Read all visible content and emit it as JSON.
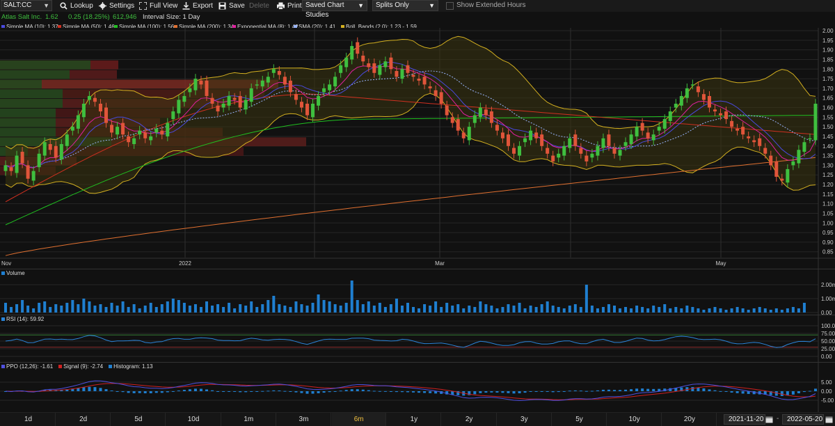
{
  "toolbar": {
    "symbol": "SALT:CC",
    "lookup": "Lookup",
    "settings": "Settings",
    "full_view": "Full View",
    "export": "Export",
    "save": "Save",
    "delete": "Delete",
    "print": "Print",
    "studies_select": "Saved Chart Studies",
    "splits_select": "Splits Only",
    "extended_hours": "Show Extended Hours"
  },
  "quote": {
    "name": "Atlas Salt Inc.",
    "last": "1.62",
    "change": "0.25 (18.25%)",
    "volume": "612,946",
    "interval": "Interval Size:  1 Day"
  },
  "colors": {
    "up": "#3fbf3f",
    "down": "#e0553a",
    "boll": "#d4b020",
    "sma10": "#4a4ae0",
    "sma50": "#d03020",
    "sma100": "#20c020",
    "sma200": "#e07030",
    "ema8": "#e020a0",
    "sma20": "#9ab6ff",
    "volume": "#1f7fd0",
    "rsi": "#2a84d8",
    "ppo": "#5050e0",
    "signal": "#d02020",
    "histogram": "#1f7fd0"
  },
  "legend": [
    {
      "label": "Simple MA (10): 1.37",
      "color": "#4a4ae0"
    },
    {
      "label": "Simple MA (50): 1.46",
      "color": "#d03020"
    },
    {
      "label": "Simple MA (100): 1.56",
      "color": "#20c020"
    },
    {
      "label": "Simple MA (200): 1.34",
      "color": "#e07030"
    },
    {
      "label": "Exponential MA (8): 1.42",
      "color": "#e020a0"
    },
    {
      "label": "SMA (20): 1.41",
      "color": "#9ab6ff"
    },
    {
      "label": "Boll. Bands (2.0): 1.23 - 1.59",
      "color": "#d4b020"
    }
  ],
  "price_axis": [
    "2.00",
    "1.95",
    "1.90",
    "1.85",
    "1.80",
    "1.75",
    "1.70",
    "1.65",
    "1.60",
    "1.55",
    "1.50",
    "1.45",
    "1.40",
    "1.35",
    "1.30",
    "1.25",
    "1.20",
    "1.15",
    "1.10",
    "1.05",
    "1.00",
    "0.95",
    "0.90",
    "0.85"
  ],
  "time_axis": [
    {
      "label": "Nov",
      "pos": "start"
    },
    {
      "label": "2022",
      "pos": "jan"
    },
    {
      "label": "Mar",
      "pos": "mar"
    },
    {
      "label": "May",
      "pos": "may"
    }
  ],
  "volume_panel": {
    "label": "Volume",
    "ticks": [
      "2.00m",
      "1.00m",
      "0.00"
    ]
  },
  "rsi_panel": {
    "label": "RSI (14): 59.92",
    "ticks": [
      "100.00",
      "75.00",
      "50.00",
      "25.00",
      "0.00"
    ]
  },
  "ppo_panel": {
    "labels": [
      {
        "text": "PPO (12,26): -1.61",
        "color": "#5050e0"
      },
      {
        "text": "Signal (9): -2.74",
        "color": "#d02020"
      },
      {
        "text": "Histogram: 1.13",
        "color": "#1f7fd0"
      }
    ],
    "ticks": [
      "5.00",
      "0.00",
      "-5.00"
    ]
  },
  "ranges": [
    {
      "label": "1d"
    },
    {
      "label": "2d"
    },
    {
      "label": "5d"
    },
    {
      "label": "10d"
    },
    {
      "label": "1m"
    },
    {
      "label": "3m"
    },
    {
      "label": "6m",
      "active": true
    },
    {
      "label": "1y"
    },
    {
      "label": "2y"
    },
    {
      "label": "3y"
    },
    {
      "label": "5y"
    },
    {
      "label": "10y"
    },
    {
      "label": "20y"
    }
  ],
  "date_from": "2021-11-20",
  "date_to": "2022-05-20",
  "chart_data": {
    "type": "candlestick",
    "ylim": [
      0.82,
      2.0
    ],
    "closes": [
      1.3,
      1.27,
      1.35,
      1.31,
      1.23,
      1.27,
      1.36,
      1.42,
      1.38,
      1.34,
      1.41,
      1.46,
      1.5,
      1.56,
      1.62,
      1.66,
      1.63,
      1.58,
      1.52,
      1.47,
      1.5,
      1.46,
      1.42,
      1.44,
      1.48,
      1.44,
      1.45,
      1.49,
      1.46,
      1.52,
      1.58,
      1.64,
      1.66,
      1.7,
      1.75,
      1.72,
      1.66,
      1.62,
      1.58,
      1.62,
      1.66,
      1.64,
      1.6,
      1.64,
      1.7,
      1.72,
      1.74,
      1.76,
      1.8,
      1.77,
      1.72,
      1.68,
      1.64,
      1.6,
      1.56,
      1.62,
      1.66,
      1.7,
      1.72,
      1.76,
      1.82,
      1.86,
      1.92,
      1.88,
      1.84,
      1.81,
      1.78,
      1.82,
      1.84,
      1.8,
      1.76,
      1.8,
      1.78,
      1.76,
      1.74,
      1.72,
      1.7,
      1.66,
      1.62,
      1.56,
      1.52,
      1.48,
      1.44,
      1.5,
      1.56,
      1.6,
      1.56,
      1.52,
      1.48,
      1.44,
      1.4,
      1.36,
      1.4,
      1.44,
      1.48,
      1.44,
      1.4,
      1.36,
      1.32,
      1.36,
      1.4,
      1.44,
      1.4,
      1.36,
      1.32,
      1.36,
      1.4,
      1.44,
      1.4,
      1.36,
      1.38,
      1.42,
      1.46,
      1.5,
      1.48,
      1.44,
      1.46,
      1.5,
      1.54,
      1.58,
      1.62,
      1.66,
      1.7,
      1.72,
      1.68,
      1.64,
      1.6,
      1.58,
      1.56,
      1.54,
      1.5,
      1.48,
      1.46,
      1.44,
      1.42,
      1.4,
      1.36,
      1.3,
      1.24,
      1.22,
      1.28,
      1.32,
      1.38,
      1.42,
      1.44,
      1.62
    ],
    "volume": [
      0.7,
      0.4,
      0.6,
      0.9,
      0.5,
      0.3,
      0.7,
      0.8,
      0.4,
      0.6,
      0.5,
      0.7,
      0.9,
      0.6,
      1.0,
      0.8,
      0.5,
      0.6,
      0.4,
      0.7,
      0.5,
      0.8,
      0.4,
      0.6,
      0.3,
      0.5,
      0.7,
      0.4,
      0.6,
      0.8,
      1.0,
      0.9,
      0.7,
      0.5,
      0.6,
      0.4,
      0.8,
      0.5,
      0.6,
      0.4,
      0.7,
      0.3,
      0.6,
      0.5,
      0.8,
      0.4,
      0.6,
      0.9,
      1.2,
      0.6,
      0.5,
      0.4,
      0.8,
      0.6,
      0.5,
      0.7,
      1.3,
      0.9,
      0.8,
      0.6,
      0.5,
      0.7,
      2.3,
      0.9,
      0.6,
      0.8,
      0.5,
      0.7,
      0.4,
      0.6,
      1.0,
      0.5,
      0.7,
      0.4,
      0.3,
      0.6,
      0.5,
      0.8,
      0.4,
      0.7,
      0.5,
      0.6,
      0.3,
      0.5,
      0.4,
      0.8,
      0.6,
      0.5,
      0.3,
      0.4,
      0.6,
      0.5,
      0.7,
      0.3,
      0.5,
      0.4,
      0.6,
      0.8,
      0.5,
      0.4,
      0.3,
      0.5,
      0.6,
      0.4,
      2.0,
      0.5,
      0.3,
      0.4,
      0.6,
      0.5,
      0.3,
      0.4,
      0.3,
      0.5,
      0.4,
      0.3,
      0.5,
      0.4,
      0.6,
      0.3,
      0.4,
      0.3,
      0.5,
      0.4,
      0.3,
      0.2,
      0.3,
      0.4,
      0.3,
      0.2,
      0.3,
      0.4,
      0.3,
      0.2,
      0.3,
      0.4,
      0.3,
      0.2,
      0.3,
      0.2,
      0.3,
      0.4,
      0.3,
      0.7
    ],
    "series": [
      {
        "name": "Simple MA (10)"
      },
      {
        "name": "Simple MA (50)"
      },
      {
        "name": "Simple MA (100)"
      },
      {
        "name": "Simple MA (200)"
      },
      {
        "name": "Exponential MA (8)"
      },
      {
        "name": "SMA (20)"
      },
      {
        "name": "Boll. Bands (2.0)"
      }
    ]
  }
}
